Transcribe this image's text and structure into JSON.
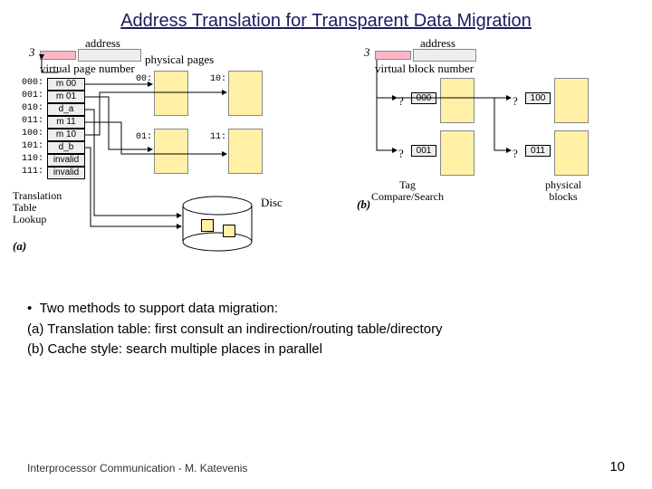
{
  "title": "Address Translation for Transparent Data Migration",
  "labels": {
    "address_a": "address",
    "address_b": "address",
    "vpn": "virtual page number",
    "vbn": "virtual block number",
    "phys_pages": "physical pages",
    "phys_blocks": "physical\nblocks",
    "disc": "Disc",
    "ttl": "Translation\nTable\nLookup",
    "tagcmp": "Tag\nCompare/Search",
    "fig_a": "(a)",
    "fig_b": "(b)",
    "three_a": "3",
    "three_b": "3"
  },
  "vpn_rows": {
    "idx": [
      "000:",
      "001:",
      "010:",
      "011:",
      "100:",
      "101:",
      "110:",
      "111:"
    ],
    "val": [
      "m 00",
      "m 01",
      "d_a",
      "m 11",
      "m 10",
      "d_b",
      "invalid",
      "invalid"
    ]
  },
  "pp": {
    "p0": "00:",
    "p1": "01:",
    "p2": "10:",
    "p3": "11:"
  },
  "b_tags": {
    "t0": "000",
    "t1": "100",
    "t2": "001",
    "t3": "011"
  },
  "q": "?",
  "bullets": {
    "lead": "Two methods to support data migration:",
    "a": "(a) Translation table: first consult an indirection/routing table/directory",
    "b": "(b) Cache style: search multiple places in parallel"
  },
  "footer": "Interprocessor Communication - M. Katevenis",
  "page": "10",
  "chart_data": {
    "type": "diagram",
    "panels": [
      {
        "id": "a",
        "method": "Translation table lookup",
        "page_table": [
          {
            "vpn": "000",
            "entry": "m 00"
          },
          {
            "vpn": "001",
            "entry": "m 01"
          },
          {
            "vpn": "010",
            "entry": "d_a"
          },
          {
            "vpn": "011",
            "entry": "m 11"
          },
          {
            "vpn": "100",
            "entry": "m 10"
          },
          {
            "vpn": "101",
            "entry": "d_b"
          },
          {
            "vpn": "110",
            "entry": "invalid"
          },
          {
            "vpn": "111",
            "entry": "invalid"
          }
        ],
        "physical_pages": [
          "00",
          "01",
          "10",
          "11"
        ],
        "disc_blocks": [
          "d_a",
          "d_b"
        ]
      },
      {
        "id": "b",
        "method": "Cache tag compare / search",
        "physical_blocks": [
          {
            "tag": "000"
          },
          {
            "tag": "100"
          },
          {
            "tag": "001"
          },
          {
            "tag": "011"
          }
        ]
      }
    ]
  }
}
